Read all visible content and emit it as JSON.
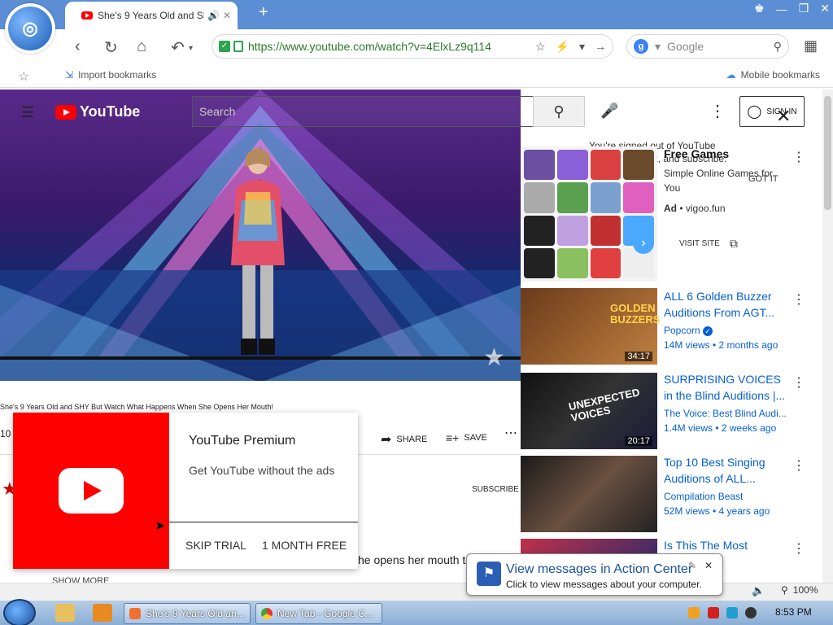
{
  "browser": {
    "tab_title": "She's 9 Years Old and SH",
    "new_tab": "+",
    "url": "https://www.youtube.com/watch?v=4ElxLz9q114",
    "search_placeholder": "Google",
    "bookmarks": {
      "import": "Import bookmarks",
      "mobile": "Mobile bookmarks"
    },
    "window_controls": [
      "—",
      "❐",
      "✕"
    ]
  },
  "youtube": {
    "logo_text": "YouTube",
    "search_placeholder": "Search",
    "signin": "SIGN IN",
    "signed_out_text": "You're signed out of YouTube\nideos, comment, and subscribe.",
    "got_it": "GOT IT",
    "video_title": "She's 9 Years Old and SHY But Watch What Happens When She Opens Her Mouth!",
    "views_prefix": "10",
    "share": "SHARE",
    "save": "SAVE",
    "subscribe": "SUBSCRIBE",
    "description_snippet": "he opens her mouth to",
    "show_more": "SHOW MORE"
  },
  "ad": {
    "title": "Free Games",
    "description": "Simple Online Games for You",
    "label": "Ad",
    "domain": "vigoo.fun",
    "visit": "VISIT SITE"
  },
  "recommendations": [
    {
      "title": "ALL 6 Golden Buzzer Auditions From AGT...",
      "channel": "Popcorn",
      "meta": "14M views • 2 months ago",
      "duration": "34:17",
      "overlay": "GOLDEN BUZZERS"
    },
    {
      "title": "SURPRISING VOICES in the Blind Auditions |...",
      "channel": "The Voice: Best Blind Audi...",
      "meta": "1.4M views • 2 weeks ago",
      "duration": "20:17",
      "overlay": "UNEXPECTED VOICES"
    },
    {
      "title": "Top 10 Best Singing Auditions of ALL...",
      "channel": "Compilation Beast",
      "meta": "52M views • 4 years ago",
      "duration": "",
      "overlay": ""
    },
    {
      "title": "Is This The Most ...male...",
      "channel": "",
      "meta": "",
      "duration": "",
      "overlay": ""
    }
  ],
  "premium": {
    "title": "YouTube Premium",
    "subtitle": "Get YouTube without the ads",
    "skip": "SKIP TRIAL",
    "month": "1 MONTH FREE"
  },
  "status": {
    "zoom": "100%"
  },
  "balloon": {
    "title": "View messages in Action Center",
    "subtitle": "Click to view messages about your computer."
  },
  "taskbar": {
    "tasks": [
      "She's 9 Years Old an...",
      "New Tab - Google C..."
    ],
    "clock": "8:53 PM"
  },
  "colors": {
    "brand_red": "#ff0000",
    "link_blue": "#065fd4",
    "chrome_blue": "#5b8ed4"
  }
}
